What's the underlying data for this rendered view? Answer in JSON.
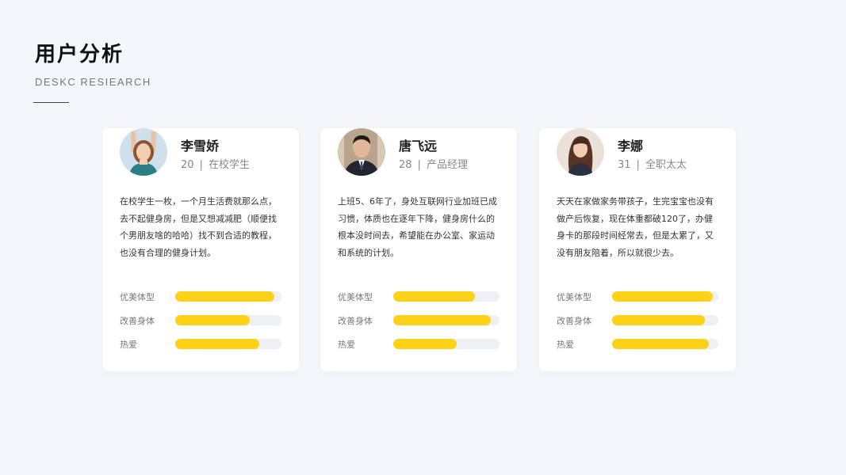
{
  "header": {
    "title": "用户分析",
    "subtitle": "DESKC RESIEARCH"
  },
  "colors": {
    "background": "#f5f6fa",
    "card": "#ffffff",
    "bar_fill": "#fcd118",
    "bar_track": "#eef0f6"
  },
  "personas": [
    {
      "name": "李雪娇",
      "age": "20",
      "role": "在校学生",
      "separator": "|",
      "avatar_icon": "portrait-young-woman-icon",
      "description": "在校学生一枚，一个月生活费就那么点，去不起健身房，但是又想减减肥（顺便找个男朋友啥的哈哈）找不到合适的教程，也没有合理的健身计划。",
      "metrics": [
        {
          "label": "优美体型",
          "value": 0.93
        },
        {
          "label": "改善身体",
          "value": 0.7
        },
        {
          "label": "热爱",
          "value": 0.79
        }
      ]
    },
    {
      "name": "唐飞远",
      "age": "28",
      "role": "产品经理",
      "separator": "|",
      "avatar_icon": "portrait-man-suit-icon",
      "description": "上班5、6年了，身处互联网行业加班已成习惯，体质也在逐年下降，健身房什么的根本没时间去，希望能在办公室、家运动和系统的计划。",
      "metrics": [
        {
          "label": "优美体型",
          "value": 0.77
        },
        {
          "label": "改善身体",
          "value": 0.92
        },
        {
          "label": "热爱",
          "value": 0.6
        }
      ]
    },
    {
      "name": "李娜",
      "age": "31",
      "role": "全职太太",
      "separator": "|",
      "avatar_icon": "portrait-woman-long-hair-icon",
      "description": "天天在家做家务带孩子，生完宝宝也没有做产后恢复，现在体重都破120了，办健身卡的那段时间经常去，但是太累了，又没有朋友陪着，所以就很少去。",
      "metrics": [
        {
          "label": "优美体型",
          "value": 0.95
        },
        {
          "label": "改善身体",
          "value": 0.87
        },
        {
          "label": "热爱",
          "value": 0.91
        }
      ]
    }
  ]
}
